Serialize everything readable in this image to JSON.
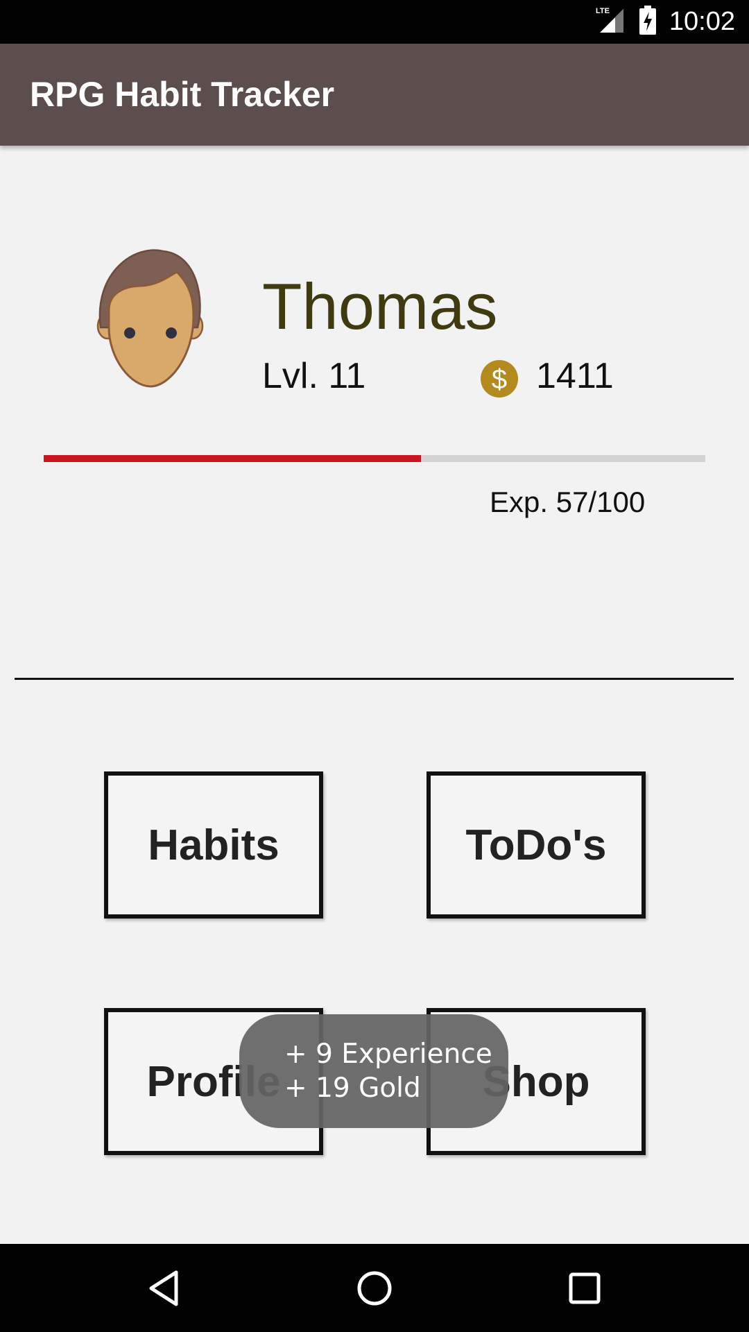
{
  "status_bar": {
    "time": "10:02",
    "network": "LTE"
  },
  "app_bar": {
    "title": "RPG Habit Tracker"
  },
  "profile": {
    "name": "Thomas",
    "level": "Lvl. 11",
    "gold": "1411",
    "experience_text": "Exp. 57/100",
    "experience_fraction": 0.57
  },
  "menu": {
    "habits": "Habits",
    "todos": "ToDo's",
    "profile": "Profile",
    "shop": "Shop"
  },
  "toast": {
    "line1": "+ 9 Experience",
    "line2": "+ 19 Gold"
  },
  "nav_bar": {
    "icons": [
      "back-icon",
      "home-icon",
      "recents-icon"
    ]
  },
  "colors": {
    "app_bar": "#5d4e4e",
    "exp_fill": "#c8151f",
    "coin": "#b48a1e",
    "name": "#3f3a10"
  }
}
